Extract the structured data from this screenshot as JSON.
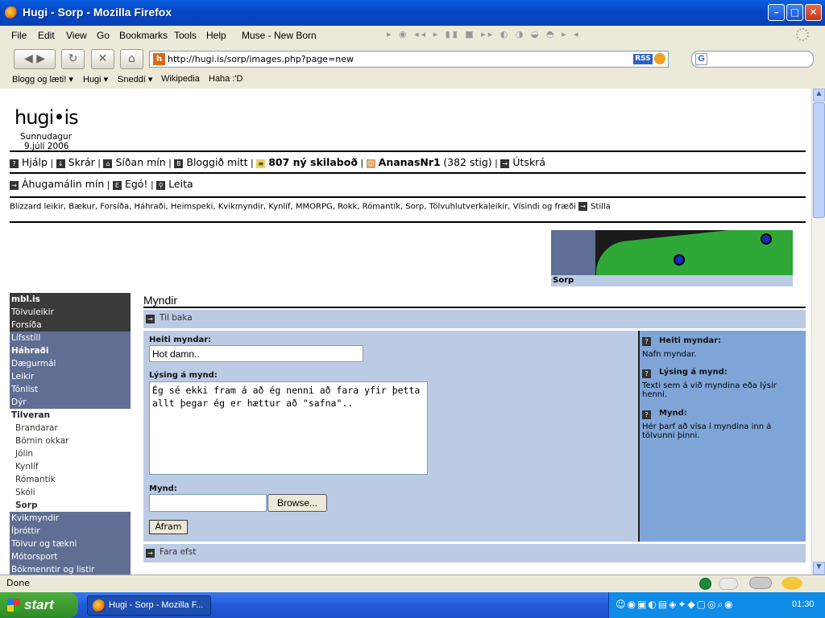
{
  "window": {
    "title": "Hugi - Sorp - Mozilla Firefox"
  },
  "menubar": [
    "File",
    "Edit",
    "View",
    "Go",
    "Bookmarks",
    "Tools",
    "Help"
  ],
  "music": "Muse - New Born",
  "address": "http://hugi.is/sorp/images.php?page=new",
  "rss": "RSS",
  "bookmarks": [
    "Blogg og læti! ▾",
    "Hugi ▾",
    "Sneddí ▾",
    "Wikipedia",
    "Haha :'D"
  ],
  "site": {
    "logo": "hugi•is",
    "day": "Sunnudagur",
    "date": "9.júlí 2006",
    "nav1": [
      "Hjálp",
      "Skrár",
      "Síðan mín",
      "Bloggið mitt"
    ],
    "messages": "807 ný skilaboð",
    "user": "AnanasNr1",
    "points": "(382 stig)",
    "logout": "Útskrá",
    "nav2": [
      "Áhugamálin mín",
      "Egó!",
      "Leita"
    ],
    "interests": "Blizzard leikir, Bækur, Forsíða, Háhraði, Heimspeki, Kvikmyndir, Kynlíf, MMORPG, Rokk, Rómantík, Sorp, Tölvuhlutverkaleikir, Vísindi og fræði",
    "settings": "Stilla",
    "banner_caption": "Sorp"
  },
  "sidebar": [
    {
      "label": "mbl.is",
      "style": "dark",
      "bold": true
    },
    {
      "label": "Tölvuleikir",
      "style": "dark"
    },
    {
      "label": "Forsíða",
      "style": "dark"
    },
    {
      "label": "Lífsstíll",
      "style": "mid"
    },
    {
      "label": "Háhraði",
      "style": "mid",
      "bold": true
    },
    {
      "label": "Dægurmál",
      "style": "mid"
    },
    {
      "label": "Leikir",
      "style": "mid"
    },
    {
      "label": "Tónlist",
      "style": "mid"
    },
    {
      "label": "Dýr",
      "style": "mid"
    },
    {
      "label": "Tilveran",
      "style": "whiteh"
    },
    {
      "label": "Brandarar",
      "style": "white"
    },
    {
      "label": "Börnin okkar",
      "style": "white"
    },
    {
      "label": "Jólin",
      "style": "white"
    },
    {
      "label": "Kynlíf",
      "style": "white"
    },
    {
      "label": "Rómantík",
      "style": "white"
    },
    {
      "label": "Skóli",
      "style": "white"
    },
    {
      "label": "Sorp",
      "style": "white",
      "bold": true
    },
    {
      "label": "Kvikmyndir",
      "style": "mid"
    },
    {
      "label": "Íþróttir",
      "style": "mid"
    },
    {
      "label": "Tölvur og tækni",
      "style": "mid"
    },
    {
      "label": "Mótorsport",
      "style": "mid"
    },
    {
      "label": "Bókmenntir og listir",
      "style": "mid"
    }
  ],
  "main": {
    "heading": "Myndir",
    "back": "Til baka",
    "title_label": "Heiti myndar:",
    "title_value": "Hot damn..",
    "desc_label": "Lýsing á mynd:",
    "desc_value": "Ég sé ekki fram á að ég nenni að fara yfir þetta allt þegar ég er hættur að \"safna\"..",
    "image_label": "Mynd:",
    "browse": "Browse...",
    "submit": "Áfram",
    "top": "Fara efst",
    "help": [
      {
        "title": "Heiti myndar:",
        "text": "Nafn myndar."
      },
      {
        "title": "Lýsing á mynd:",
        "text": "Texti sem á við myndina eða lýsir henni."
      },
      {
        "title": "Mynd:",
        "text": "Hér þarf að vísa í myndina inn á tölvunni þinni."
      }
    ]
  },
  "status": "Done",
  "taskbar": {
    "start": "start",
    "task": "Hugi - Sorp - Mozilla F...",
    "clock": "01:30"
  },
  "colors": {
    "titlebar": "#0648c8",
    "sidebar_dark": "#3a3a3a",
    "sidebar_mid": "#5f6e92",
    "form_bg": "#bccbe4",
    "help_bg": "#7fa5d8"
  }
}
